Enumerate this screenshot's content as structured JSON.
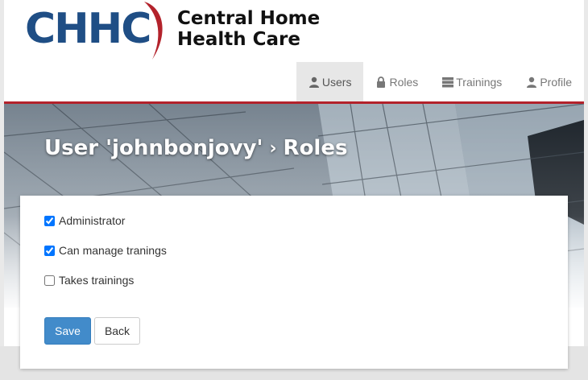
{
  "header": {
    "logo_text": "CHHC",
    "company_line1": "Central Home",
    "company_line2": "Health Care"
  },
  "nav": {
    "items": [
      {
        "label": "Users",
        "icon": "user-icon",
        "active": true
      },
      {
        "label": "Roles",
        "icon": "lock-icon",
        "active": false
      },
      {
        "label": "Trainings",
        "icon": "server-icon",
        "active": false
      },
      {
        "label": "Profile",
        "icon": "user-icon",
        "active": false
      }
    ]
  },
  "hero": {
    "title_user": "User 'johnbonjovy'",
    "separator": "›",
    "title_section": "Roles"
  },
  "form": {
    "roles": [
      {
        "label": "Administrator",
        "checked": true
      },
      {
        "label": "Can manage tranings",
        "checked": true
      },
      {
        "label": "Takes trainings",
        "checked": false
      }
    ],
    "save_label": "Save",
    "back_label": "Back"
  },
  "colors": {
    "accent": "#b3222b",
    "primary_button": "#428bca",
    "logo_blue": "#1f4e85"
  }
}
